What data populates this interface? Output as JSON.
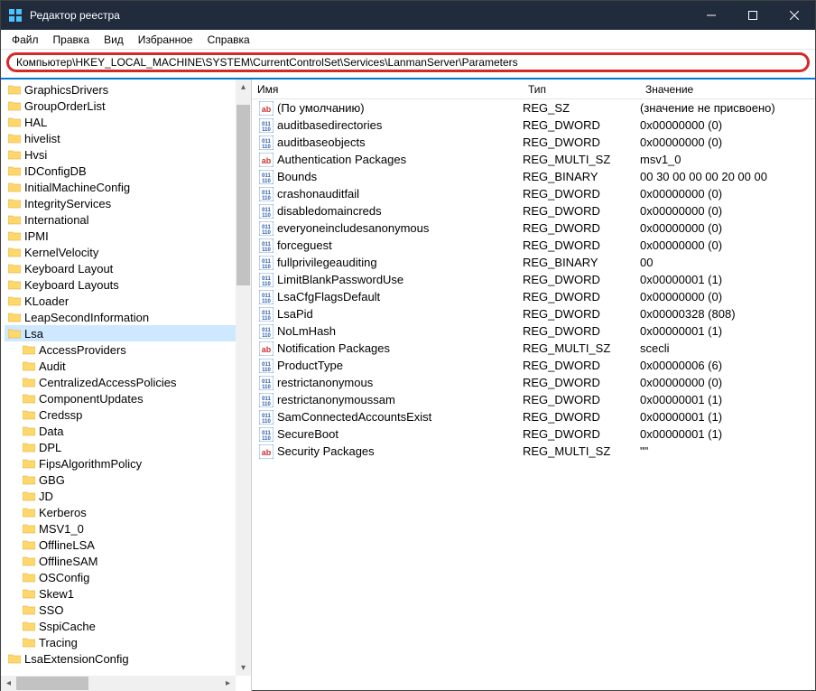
{
  "window": {
    "title": "Редактор реестра"
  },
  "menu": {
    "file": "Файл",
    "edit": "Правка",
    "view": "Вид",
    "favorites": "Избранное",
    "help": "Справка"
  },
  "address": "Компьютер\\HKEY_LOCAL_MACHINE\\SYSTEM\\CurrentControlSet\\Services\\LanmanServer\\Parameters",
  "columns": {
    "name": "Имя",
    "type": "Тип",
    "data": "Значение"
  },
  "tree": [
    {
      "label": "GraphicsDrivers",
      "indent": false
    },
    {
      "label": "GroupOrderList",
      "indent": false
    },
    {
      "label": "HAL",
      "indent": false
    },
    {
      "label": "hivelist",
      "indent": false
    },
    {
      "label": "Hvsi",
      "indent": false
    },
    {
      "label": "IDConfigDB",
      "indent": false
    },
    {
      "label": "InitialMachineConfig",
      "indent": false
    },
    {
      "label": "IntegrityServices",
      "indent": false
    },
    {
      "label": "International",
      "indent": false
    },
    {
      "label": "IPMI",
      "indent": false
    },
    {
      "label": "KernelVelocity",
      "indent": false
    },
    {
      "label": "Keyboard Layout",
      "indent": false
    },
    {
      "label": "Keyboard Layouts",
      "indent": false
    },
    {
      "label": "KLoader",
      "indent": false
    },
    {
      "label": "LeapSecondInformation",
      "indent": false
    },
    {
      "label": "Lsa",
      "indent": false,
      "selected": true
    },
    {
      "label": "AccessProviders",
      "indent": true
    },
    {
      "label": "Audit",
      "indent": true
    },
    {
      "label": "CentralizedAccessPolicies",
      "indent": true
    },
    {
      "label": "ComponentUpdates",
      "indent": true
    },
    {
      "label": "Credssp",
      "indent": true
    },
    {
      "label": "Data",
      "indent": true
    },
    {
      "label": "DPL",
      "indent": true
    },
    {
      "label": "FipsAlgorithmPolicy",
      "indent": true
    },
    {
      "label": "GBG",
      "indent": true
    },
    {
      "label": "JD",
      "indent": true
    },
    {
      "label": "Kerberos",
      "indent": true
    },
    {
      "label": "MSV1_0",
      "indent": true
    },
    {
      "label": "OfflineLSA",
      "indent": true
    },
    {
      "label": "OfflineSAM",
      "indent": true
    },
    {
      "label": "OSConfig",
      "indent": true
    },
    {
      "label": "Skew1",
      "indent": true
    },
    {
      "label": "SSO",
      "indent": true
    },
    {
      "label": "SspiCache",
      "indent": true
    },
    {
      "label": "Tracing",
      "indent": true
    },
    {
      "label": "LsaExtensionConfig",
      "indent": false
    }
  ],
  "values": [
    {
      "icon": "str",
      "name": "(По умолчанию)",
      "type": "REG_SZ",
      "data": "(значение не присвоено)"
    },
    {
      "icon": "bin",
      "name": "auditbasedirectories",
      "type": "REG_DWORD",
      "data": "0x00000000 (0)"
    },
    {
      "icon": "bin",
      "name": "auditbaseobjects",
      "type": "REG_DWORD",
      "data": "0x00000000 (0)"
    },
    {
      "icon": "str",
      "name": "Authentication Packages",
      "type": "REG_MULTI_SZ",
      "data": "msv1_0"
    },
    {
      "icon": "bin",
      "name": "Bounds",
      "type": "REG_BINARY",
      "data": "00 30 00 00 00 20 00 00"
    },
    {
      "icon": "bin",
      "name": "crashonauditfail",
      "type": "REG_DWORD",
      "data": "0x00000000 (0)"
    },
    {
      "icon": "bin",
      "name": "disabledomaincreds",
      "type": "REG_DWORD",
      "data": "0x00000000 (0)"
    },
    {
      "icon": "bin",
      "name": "everyoneincludesanonymous",
      "type": "REG_DWORD",
      "data": "0x00000000 (0)"
    },
    {
      "icon": "bin",
      "name": "forceguest",
      "type": "REG_DWORD",
      "data": "0x00000000 (0)"
    },
    {
      "icon": "bin",
      "name": "fullprivilegeauditing",
      "type": "REG_BINARY",
      "data": "00"
    },
    {
      "icon": "bin",
      "name": "LimitBlankPasswordUse",
      "type": "REG_DWORD",
      "data": "0x00000001 (1)"
    },
    {
      "icon": "bin",
      "name": "LsaCfgFlagsDefault",
      "type": "REG_DWORD",
      "data": "0x00000000 (0)"
    },
    {
      "icon": "bin",
      "name": "LsaPid",
      "type": "REG_DWORD",
      "data": "0x00000328 (808)"
    },
    {
      "icon": "bin",
      "name": "NoLmHash",
      "type": "REG_DWORD",
      "data": "0x00000001 (1)"
    },
    {
      "icon": "str",
      "name": "Notification Packages",
      "type": "REG_MULTI_SZ",
      "data": "scecli"
    },
    {
      "icon": "bin",
      "name": "ProductType",
      "type": "REG_DWORD",
      "data": "0x00000006 (6)"
    },
    {
      "icon": "bin",
      "name": "restrictanonymous",
      "type": "REG_DWORD",
      "data": "0x00000000 (0)"
    },
    {
      "icon": "bin",
      "name": "restrictanonymoussam",
      "type": "REG_DWORD",
      "data": "0x00000001 (1)"
    },
    {
      "icon": "bin",
      "name": "SamConnectedAccountsExist",
      "type": "REG_DWORD",
      "data": "0x00000001 (1)"
    },
    {
      "icon": "bin",
      "name": "SecureBoot",
      "type": "REG_DWORD",
      "data": "0x00000001 (1)"
    },
    {
      "icon": "str",
      "name": "Security Packages",
      "type": "REG_MULTI_SZ",
      "data": "\"\""
    }
  ]
}
